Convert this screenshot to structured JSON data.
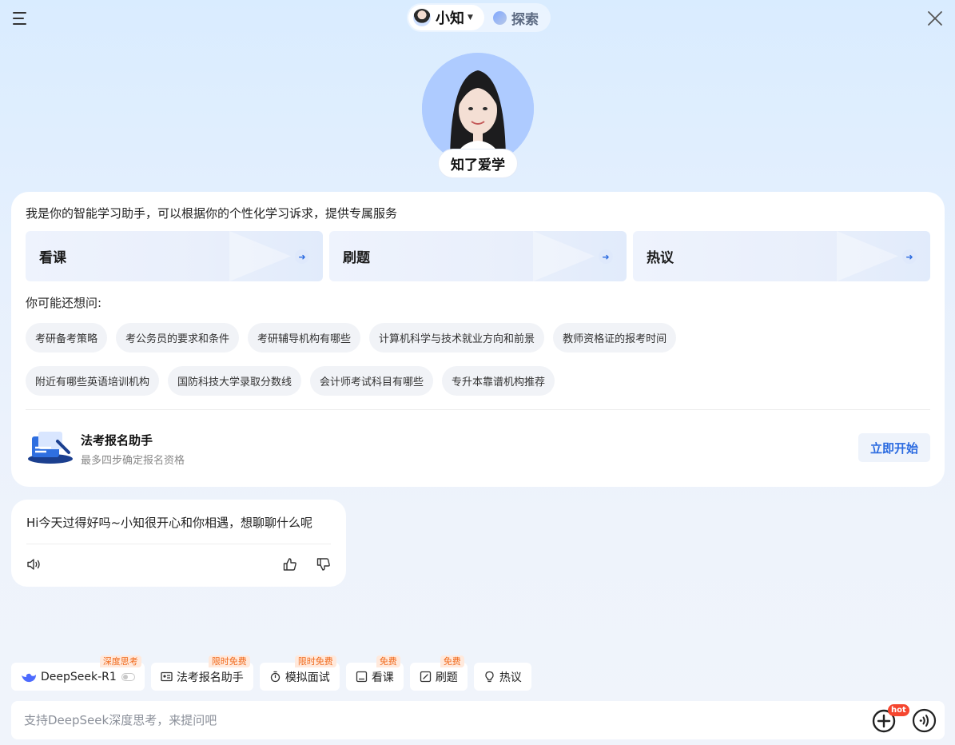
{
  "header": {
    "assistant_name": "小知",
    "explore_label": "探索"
  },
  "hero": {
    "name": "知了爱学"
  },
  "card": {
    "intro": "我是你的智能学习助手，可以根据你的个性化学习诉求，提供专属服务",
    "features": [
      {
        "label": "看课"
      },
      {
        "label": "刷题"
      },
      {
        "label": "热议"
      }
    ],
    "suggest_title": "你可能还想问:",
    "suggestions_row1": [
      "考研备考策略",
      "考公务员的要求和条件",
      "考研辅导机构有哪些",
      "计算机科学与技术就业方向和前景",
      "教师资格证的报考时间"
    ],
    "suggestions_row2": [
      "附近有哪些英语培训机构",
      "国防科技大学录取分数线",
      "会计师考试科目有哪些",
      "专升本靠谱机构推荐"
    ],
    "promo": {
      "title": "法考报名助手",
      "subtitle": "最多四步确定报名资格",
      "button": "立即开始"
    }
  },
  "message": {
    "text": "Hi今天过得好吗~小知很开心和你相遇，想聊聊什么呢"
  },
  "tools": [
    {
      "label": "DeepSeek-R1",
      "tag": "深度思考",
      "icon": "deepseek-whale-icon"
    },
    {
      "label": "法考报名助手",
      "tag": "限时免费",
      "icon": "id-card-icon"
    },
    {
      "label": "模拟面试",
      "tag": "限时免费",
      "icon": "stopwatch-icon"
    },
    {
      "label": "看课",
      "tag": "免费",
      "icon": "video-icon"
    },
    {
      "label": "刷题",
      "tag": "免费",
      "icon": "edit-icon"
    },
    {
      "label": "热议",
      "icon": "bulb-icon"
    }
  ],
  "input": {
    "placeholder": "支持DeepSeek深度思考，来提问吧",
    "hot_badge": "hot"
  },
  "colors": {
    "accent": "#2a6ae0",
    "tag": "#f06a1d",
    "hot": "#f5462f"
  }
}
